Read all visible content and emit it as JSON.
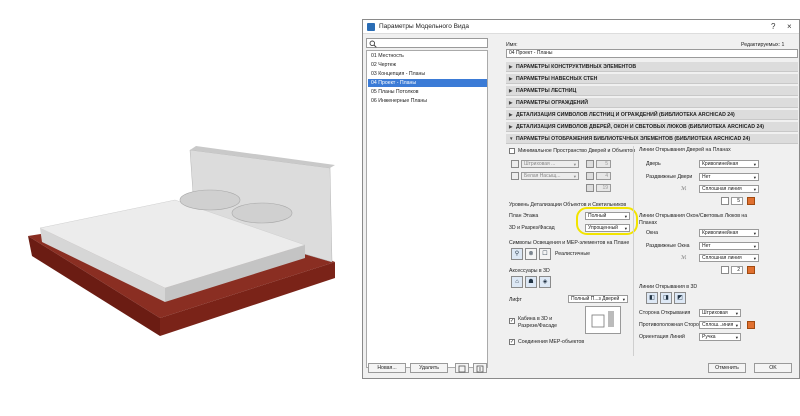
{
  "dialog": {
    "title": "Параметры Модельного Вида",
    "help_label": "?",
    "close_label": "×",
    "name_label": "Имя:",
    "editable_label": "Редактируемых: 1",
    "name_value": "04 Проект - Планы",
    "new_button": "Новая...",
    "delete_button": "Удалить",
    "cancel_button": "Отменить",
    "ok_button": "OK"
  },
  "views": [
    "01 Местность",
    "02 Чертеж",
    "03 Концепция - Планы",
    "04 Проект - Планы",
    "05 Планы Потолков",
    "06 Инженерные Планы"
  ],
  "sections": [
    "ПАРАМЕТРЫ КОНСТРУКТИВНЫХ ЭЛЕМЕНТОВ",
    "ПАРАМЕТРЫ НАВЕСНЫХ СТЕН",
    "ПАРАМЕТРЫ ЛЕСТНИЦ",
    "ПАРАМЕТРЫ ОГРАЖДЕНИЙ",
    "ДЕТАЛИЗАЦИЯ СИМВОЛОВ ЛЕСТНИЦ И ОГРАЖДЕНИЙ (БИБЛИОТЕКА ARCHICAD 24)",
    "ДЕТАЛИЗАЦИЯ СИМВОЛОВ ДВЕРЕЙ, ОКОН И СВЕТОВЫХ ЛЮКОВ (БИБЛИОТЕКА ARCHICAD 24)",
    "ПАРАМЕТРЫ ОТОБРАЖЕНИЯ БИБЛИОТЕЧНЫХ ЭЛЕМЕНТОВ (БИБЛИОТЕКА ARCHICAD 24)"
  ],
  "left_col": {
    "min_space_label": "Минимальное Пространство Дверей и Объектов",
    "line_type_value": "Штриховая ...",
    "fill_value": "Белая Насыщ...",
    "pen1": "5",
    "pen2": "4",
    "pen3": "19",
    "detail_level_label": "Уровень Детализации Объектов и Светильников",
    "floor_plan_label": "План Этажа",
    "floor_plan_value": "Полный",
    "section_3d_label": "3D и Разрез/Фасад",
    "section_3d_value": "Упрощенный",
    "lighting_label": "Символы Освещения и MEP-элементов на Плане",
    "realistic_label": "Реалистичные",
    "accessories_label": "Аксессуары в 3D",
    "lift_label": "Лифт",
    "lift_value": "Полный П...з Дверей",
    "cabin_label": "Кабина в 3D и Разрезе/Фасаде",
    "mep_connections_label": "Соединения MEP-объектов"
  },
  "right_col": {
    "door_lines_title": "Линии Открывания Дверей на Планах",
    "door_label": "Дверь",
    "door_value": "Криволинейная",
    "sliding_door_label": "Раздвижные Двери",
    "sliding_door_value": "Нет",
    "solid_line": "Сплошная линия",
    "pen_a": "5",
    "window_lines_title": "Линии Открывания Окон/Световых Люков на Планах",
    "window_label": "Окна",
    "window_value": "Криволинейная",
    "sliding_window_label": "Раздвижные Окна",
    "sliding_window_value": "Нет",
    "pen_b": "2",
    "lines_3d_title": "Линии Открывания в 3D",
    "opening_side_label": "Сторона Открывания",
    "opening_side_value": "Штриховая",
    "opposite_side_label": "Противоположная Сторона",
    "opposite_side_value": "Сплош...иния",
    "orientation_label": "Ориентация Линий",
    "orientation_value": "Ручка"
  }
}
